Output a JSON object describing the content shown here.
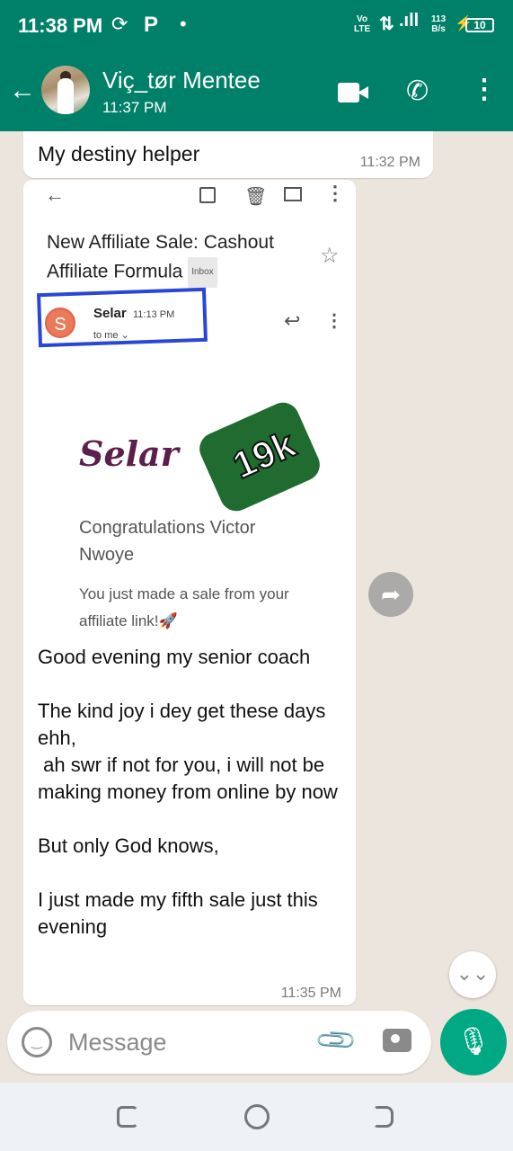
{
  "status_bar": {
    "time": "11:38 PM",
    "volte": "Vo LTE",
    "network": "4G",
    "speed": "113 B/s",
    "battery": "10"
  },
  "header": {
    "contact_name": "Viç_tør Mentee",
    "last_seen": "11:37 PM"
  },
  "messages": [
    {
      "text": "My destiny helper",
      "time": "11:32 PM"
    },
    {
      "screenshot": {
        "subject": "New Affiliate Sale: Cashout Affiliate Formula",
        "label": "Inbox",
        "sender_initial": "S",
        "sender": "Selar",
        "sender_time": "11:13 PM",
        "to": "to me ⌄",
        "logo_text": "Selar",
        "badge": "19k",
        "congrats": "Congratulations Victor Nwoye",
        "sale_text": "You just made a sale from your affiliate link!🚀"
      },
      "text": "Good evening my senior coach\n\nThe kind joy i dey get these days ehh,\n ah swr if not for you, i will not be making money from online by now\n\nBut only God knows,\n\nI just made my fifth sale just this evening",
      "time": "11:35 PM"
    }
  ],
  "composer": {
    "placeholder": "Message"
  },
  "colors": {
    "header": "#008069",
    "mic_button": "#00a884",
    "chat_bg": "#ece5dd"
  }
}
